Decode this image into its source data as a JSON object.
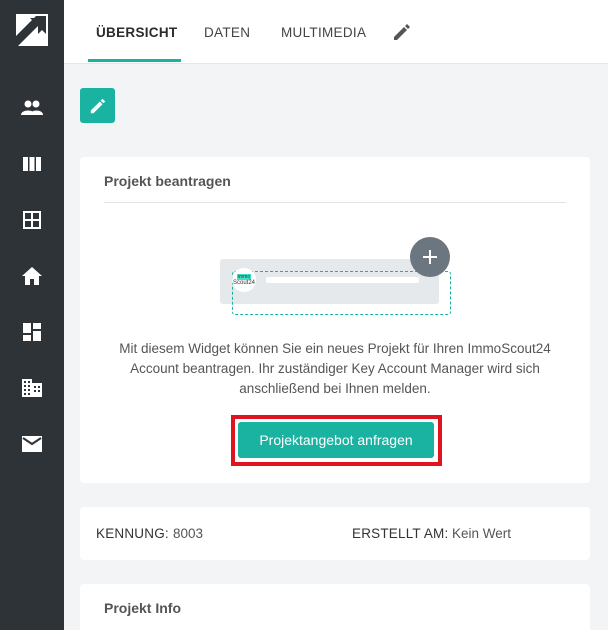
{
  "sidebar": {
    "items": [
      {
        "icon": "people-icon"
      },
      {
        "icon": "columns-icon"
      },
      {
        "icon": "grid-icon"
      },
      {
        "icon": "home-icon"
      },
      {
        "icon": "dashboard-icon"
      },
      {
        "icon": "building-icon"
      },
      {
        "icon": "mail-icon"
      }
    ]
  },
  "tabs": [
    {
      "label": "ÜBERSICHT",
      "active": true
    },
    {
      "label": "DATEN",
      "active": false
    },
    {
      "label": "MULTIMEDIA",
      "active": false
    }
  ],
  "project_card": {
    "title": "Projekt beantragen",
    "logo_line1": "immo",
    "logo_line2": "Scout24",
    "description": "Mit diesem Widget können Sie ein neues Projekt für Ihren ImmoScout24 Account beantragen. Ihr zuständiger Key Account Manager wird sich anschließend bei Ihnen melden.",
    "button_label": "Projektangebot anfragen"
  },
  "meta": {
    "kennung_label": "KENNUNG:",
    "kennung_value": "8003",
    "erstellt_label": "ERSTELLT AM:",
    "erstellt_value": "Kein Wert"
  },
  "info_card": {
    "title": "Projekt Info"
  },
  "colors": {
    "accent": "#1ab2a1",
    "sidebar": "#2e3338",
    "highlight": "#e0141e"
  }
}
